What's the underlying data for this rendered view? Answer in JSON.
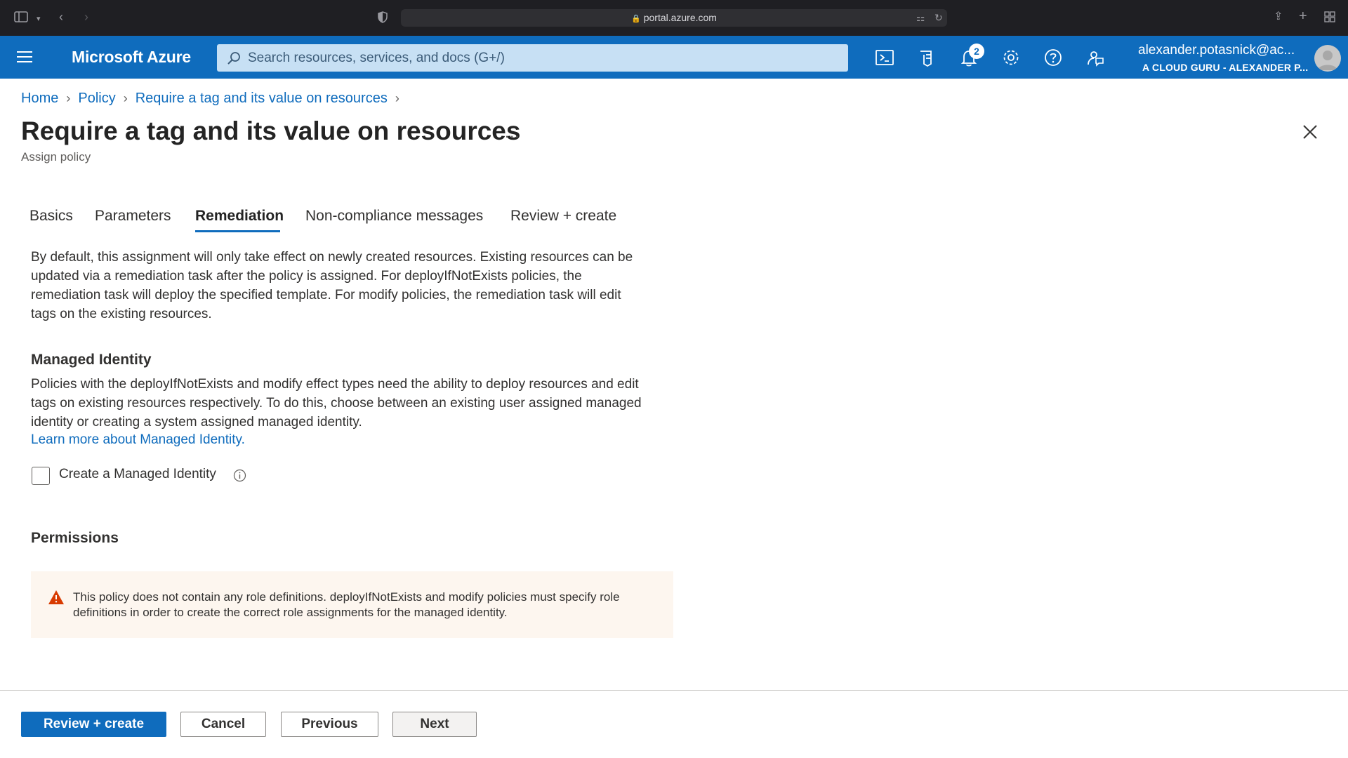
{
  "browser": {
    "url": "portal.azure.com"
  },
  "topbar": {
    "brand": "Microsoft Azure",
    "search_placeholder": "Search resources, services, and docs (G+/)",
    "notification_count": "2",
    "user_name": "alexander.potasnick@ac...",
    "user_org": "A CLOUD GURU - ALEXANDER P..."
  },
  "breadcrumb": [
    "Home",
    "Policy",
    "Require a tag and its value on resources"
  ],
  "page": {
    "title": "Require a tag and its value on resources",
    "subtitle": "Assign policy",
    "more": "..."
  },
  "tabs": [
    {
      "label": "Basics",
      "active": false
    },
    {
      "label": "Parameters",
      "active": false
    },
    {
      "label": "Remediation",
      "active": true
    },
    {
      "label": "Non-compliance messages",
      "active": false
    },
    {
      "label": "Review + create",
      "active": false
    }
  ],
  "remediation": {
    "intro_lines": [
      "By default, this assignment will only take effect on newly created resources. Existing resources can be",
      "updated via a remediation task after the policy is assigned. For deployIfNotExists policies, the",
      "remediation task will deploy the specified template. For modify policies, the remediation task will edit",
      "tags on the existing resources."
    ],
    "managed_identity_heading": "Managed Identity",
    "managed_identity_lines": [
      "Policies with the deployIfNotExists and modify effect types need the ability to deploy resources and edit",
      "tags on existing resources respectively. To do this, choose between an existing user assigned managed",
      "identity or creating a system assigned managed identity."
    ],
    "learn_more": "Learn more about Managed Identity.",
    "checkbox_label": "Create a Managed Identity",
    "checkbox_checked": false,
    "permissions_heading": "Permissions",
    "warning_lines": [
      "This policy does not contain any role definitions. deployIfNotExists and modify policies must specify role",
      "definitions in order to create the correct role assignments for the managed identity."
    ]
  },
  "footer": {
    "review_create": "Review + create",
    "cancel": "Cancel",
    "previous": "Previous",
    "next": "Next"
  },
  "colors": {
    "azure_blue": "#0f6cbd",
    "warning_bg": "#fdf6ef",
    "warning_icon": "#d83b01"
  }
}
